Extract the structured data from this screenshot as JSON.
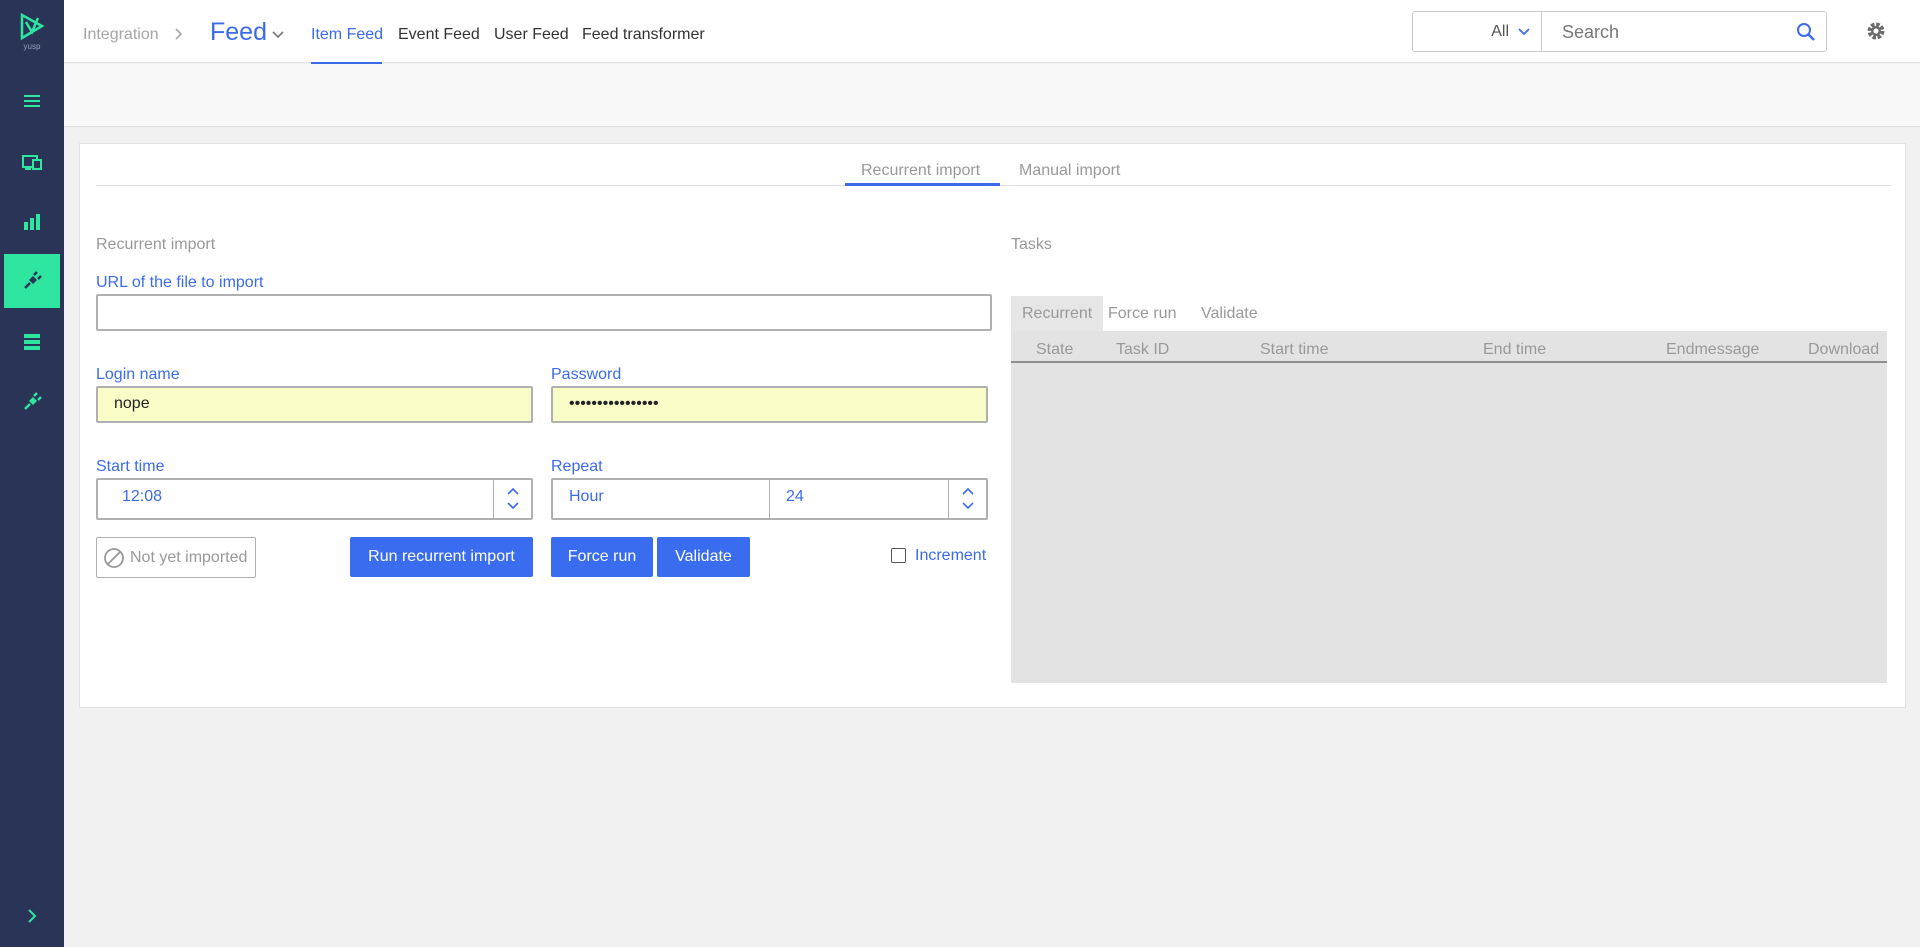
{
  "sidebar": {
    "logo_text": "yusp",
    "items": [
      {
        "icon": "menu-icon"
      },
      {
        "icon": "devices-icon"
      },
      {
        "icon": "bar-chart-icon"
      },
      {
        "icon": "plug-icon",
        "active": true
      },
      {
        "icon": "server-icon"
      },
      {
        "icon": "plug-outline-icon"
      }
    ],
    "expand_icon": "chevron-right-icon",
    "accent_color": "#2ee6a0",
    "bg_color": "#2a3457"
  },
  "header": {
    "breadcrumb": "Integration",
    "app_title": "Feed",
    "nav": [
      "Item Feed",
      "Event Feed",
      "User Feed",
      "Feed transformer"
    ],
    "active_nav": "Item Feed",
    "scope_value": "All",
    "search_placeholder": "Search",
    "accent_color": "#3b6be8"
  },
  "panel": {
    "tabs": [
      "Recurrent import",
      "Manual import"
    ],
    "active_tab": "Recurrent import",
    "form": {
      "title": "Recurrent import",
      "url_label": "URL of the file to import",
      "url_value": "",
      "login_label": "Login name",
      "login_value": "nope",
      "password_label": "Password",
      "password_value": "••••••••••••••••",
      "start_label": "Start time",
      "start_value": "12:08",
      "repeat_label": "Repeat",
      "repeat_unit": "Hour",
      "repeat_value": "24",
      "status_text": "Not yet imported",
      "run_button": "Run recurrent import",
      "force_button": "Force run",
      "validate_button": "Validate",
      "increment_label": "Increment",
      "increment_checked": false
    },
    "tasks": {
      "title": "Tasks",
      "tabs": [
        "Recurrent",
        "Force run",
        "Validate"
      ],
      "active_tab": "Recurrent",
      "columns": [
        "State",
        "Task ID",
        "Start time",
        "End time",
        "Endmessage",
        "Download"
      ],
      "rows": []
    }
  }
}
